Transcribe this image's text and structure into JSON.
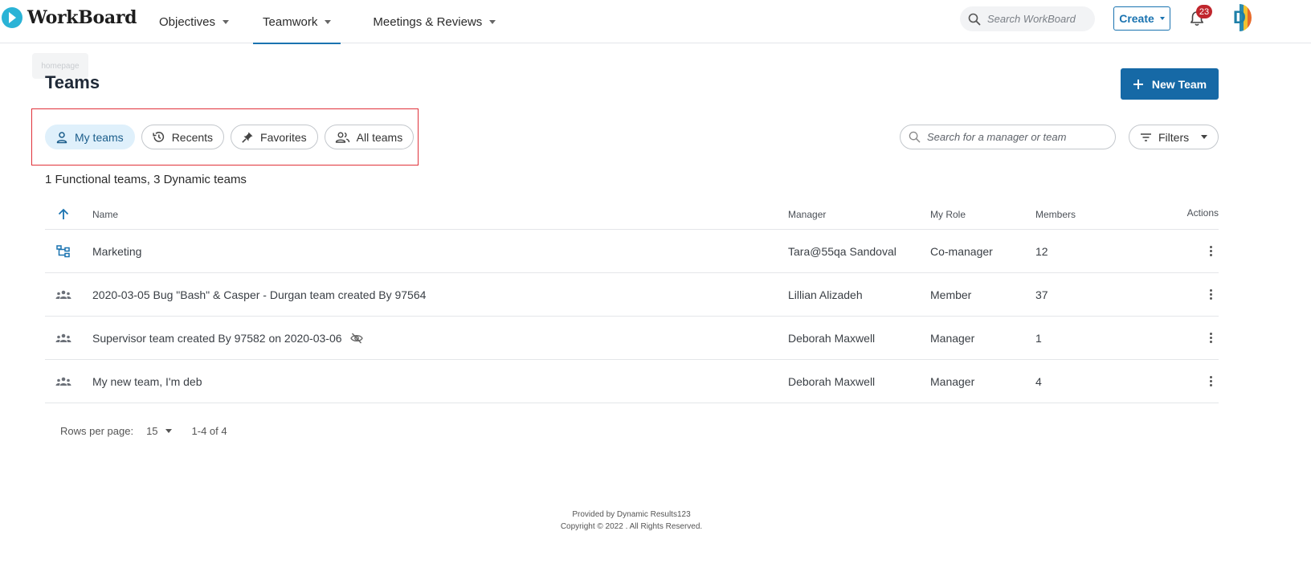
{
  "header": {
    "brand": "WorkBoard",
    "nav": [
      {
        "label": "Objectives"
      },
      {
        "label": "Teamwork"
      },
      {
        "label": "Meetings & Reviews"
      }
    ],
    "search_placeholder": "Search WorkBoard",
    "create_label": "Create",
    "notification_count": "23",
    "avatar_letter": "D",
    "avatar_stripe_colors": [
      "#2b8bb0",
      "#f2c230",
      "#e86a2a"
    ],
    "tooltip": "homepage"
  },
  "page": {
    "title": "Teams",
    "new_team_label": "New Team",
    "chips": [
      {
        "label": "My teams",
        "icon": "person-icon",
        "active": true
      },
      {
        "label": "Recents",
        "icon": "history-icon",
        "active": false
      },
      {
        "label": "Favorites",
        "icon": "pin-icon",
        "active": false
      },
      {
        "label": "All teams",
        "icon": "people-icon",
        "active": false
      }
    ],
    "team_search_placeholder": "Search for a manager or team",
    "filters_label": "Filters",
    "summary": "1 Functional teams, 3 Dynamic teams"
  },
  "table": {
    "headers": {
      "name": "Name",
      "manager": "Manager",
      "role": "My Role",
      "members": "Members",
      "actions": "Actions"
    },
    "rows": [
      {
        "name": "Marketing",
        "manager": "Tara@55qa Sandoval",
        "role": "Co-manager",
        "members": "12",
        "type": "functional",
        "hidden": false
      },
      {
        "name": "2020-03-05 Bug \"Bash\" & Casper - Durgan team created By 97564",
        "manager": "Lillian Alizadeh",
        "role": "Member",
        "members": "37",
        "type": "dynamic",
        "hidden": false
      },
      {
        "name": "Supervisor team created By 97582 on 2020-03-06",
        "manager": "Deborah Maxwell",
        "role": "Manager",
        "members": "1",
        "type": "dynamic",
        "hidden": true
      },
      {
        "name": "My new team, I'm deb",
        "manager": "Deborah Maxwell",
        "role": "Manager",
        "members": "4",
        "type": "dynamic",
        "hidden": false
      }
    ]
  },
  "pagination": {
    "rows_per_page_label": "Rows per page:",
    "rows_per_page": "15",
    "range": "1-4 of 4"
  },
  "footer": {
    "line1": "Provided by Dynamic Results123",
    "line2": "Copyright © 2022 . All Rights Reserved."
  },
  "colors": {
    "accent": "#1669a6",
    "highlight_border": "#e0323a",
    "badge": "#c0262d",
    "chip_active_bg": "#dff0fb"
  }
}
